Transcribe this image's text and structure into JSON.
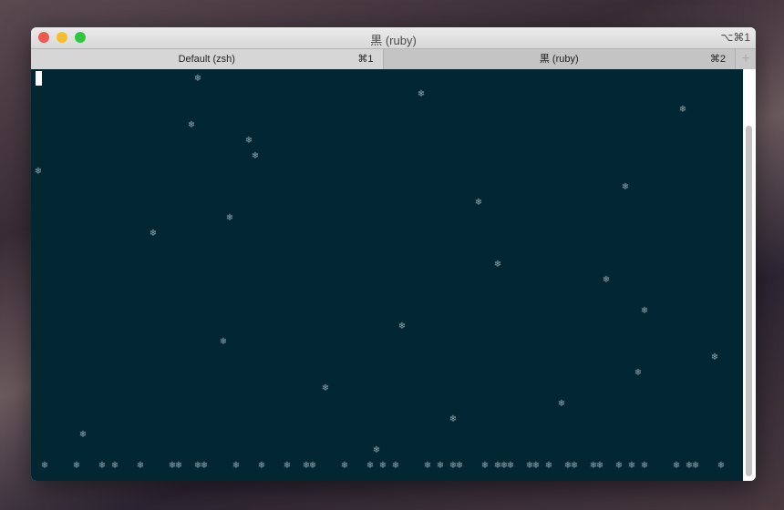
{
  "window": {
    "title": "黒 (ruby)",
    "shortcut": "⌥⌘1"
  },
  "tabs": [
    {
      "label": "Default (zsh)",
      "shortcut": "⌘1"
    },
    {
      "label": "黒 (ruby)",
      "shortcut": "⌘2"
    }
  ],
  "new_tab_label": "+",
  "terminal": {
    "snowflake_char": "❄"
  },
  "colors": {
    "terminal_bg": "#022733",
    "close": "#ee5a52",
    "minimize": "#f6be2f",
    "zoom": "#2cc840"
  }
}
